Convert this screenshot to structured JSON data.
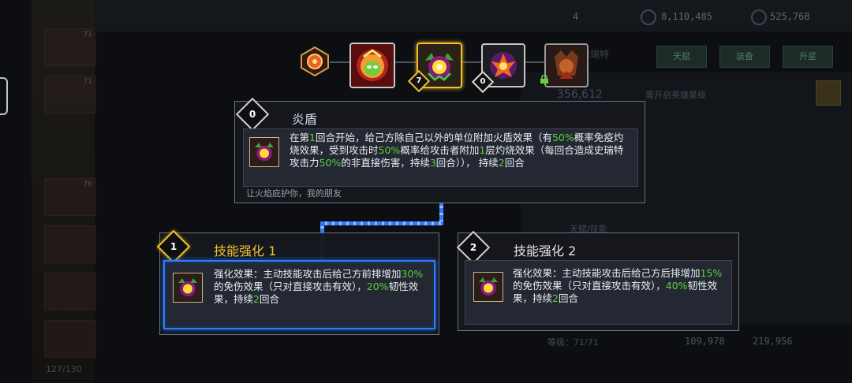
{
  "background": {
    "stats": [
      "4",
      "8,110,485",
      "525,768"
    ],
    "tabs": [
      "天赋",
      "装备",
      "升星"
    ],
    "hero_name": "史瑞特",
    "power": "356,612",
    "upgrade_hint": "需开启英雄星级",
    "card_levels": [
      "71",
      "71",
      "76"
    ],
    "level_label": "等级：71/71",
    "bottom_stats": [
      "109,978",
      "219,956"
    ],
    "roster_count": "127/130",
    "skill_section": "天赋/技能"
  },
  "skill_chain": {
    "badges": [
      "7",
      "0"
    ]
  },
  "main_skill": {
    "badge": "0",
    "title": "炎盾",
    "description_parts": [
      {
        "t": "在第",
        "h": false
      },
      {
        "t": "1",
        "h": true
      },
      {
        "t": "回合开始，给己方除自己以外的单位附加火盾效果（有",
        "h": false
      },
      {
        "t": "50%",
        "h": true
      },
      {
        "t": "概率免疫灼烧效果，受到攻击时",
        "h": false
      },
      {
        "t": "50%",
        "h": true
      },
      {
        "t": "概率给攻击者附加",
        "h": false
      },
      {
        "t": "1",
        "h": true
      },
      {
        "t": "层灼烧效果（每回合造成史瑞特攻击力",
        "h": false
      },
      {
        "t": "50%",
        "h": true
      },
      {
        "t": "的非直接伤害，持续",
        "h": false
      },
      {
        "t": "3",
        "h": true
      },
      {
        "t": "回合））， 持续",
        "h": false
      },
      {
        "t": "2",
        "h": true
      },
      {
        "t": "回合",
        "h": false
      }
    ],
    "flavor": "让火焰庇护你，我的朋友"
  },
  "enhance_1": {
    "badge": "1",
    "title": "技能强化 1",
    "description_parts": [
      {
        "t": "强化效果：主动技能攻击后给己方前排增加",
        "h": false
      },
      {
        "t": "30%",
        "h": true
      },
      {
        "t": "的免伤效果（只对直接攻击有效），",
        "h": false
      },
      {
        "t": "20%",
        "h": true
      },
      {
        "t": "韧性效果，持续",
        "h": false
      },
      {
        "t": "2",
        "h": true
      },
      {
        "t": "回合",
        "h": false
      }
    ]
  },
  "enhance_2": {
    "badge": "2",
    "title": "技能强化 2",
    "description_parts": [
      {
        "t": "强化效果：主动技能攻击后给己方后排增加",
        "h": false
      },
      {
        "t": "15%",
        "h": true
      },
      {
        "t": "的免伤效果（只对直接攻击有效），",
        "h": false
      },
      {
        "t": "40%",
        "h": true
      },
      {
        "t": "韧性效果，持续",
        "h": false
      },
      {
        "t": "2",
        "h": true
      },
      {
        "t": "回合",
        "h": false
      }
    ]
  },
  "colors": {
    "highlight": "#56d43a",
    "active_border": "#2f7dff",
    "gold_badge": "#f2c12e"
  }
}
